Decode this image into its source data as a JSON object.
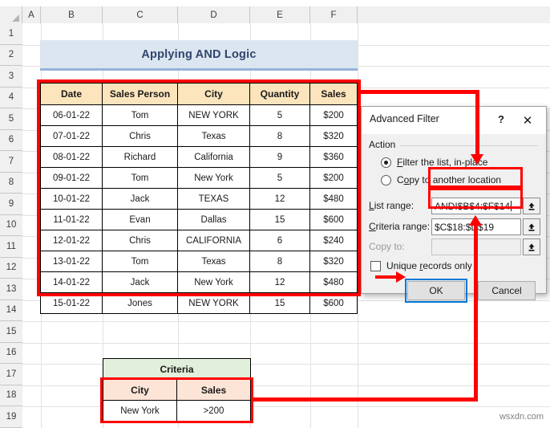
{
  "sheet": {
    "column_headers": [
      "A",
      "B",
      "C",
      "D",
      "E",
      "F"
    ],
    "row_headers": [
      "1",
      "2",
      "3",
      "4",
      "5",
      "6",
      "7",
      "8",
      "9",
      "10",
      "11",
      "12",
      "13",
      "14",
      "15",
      "16",
      "17",
      "18",
      "19"
    ],
    "banner_title": "Applying AND Logic"
  },
  "data_table": {
    "columns": [
      "Date",
      "Sales Person",
      "City",
      "Quantity",
      "Sales"
    ],
    "rows": [
      [
        "06-01-22",
        "Tom",
        "NEW YORK",
        "5",
        "$200"
      ],
      [
        "07-01-22",
        "Chris",
        "Texas",
        "8",
        "$320"
      ],
      [
        "08-01-22",
        "Richard",
        "California",
        "9",
        "$360"
      ],
      [
        "09-01-22",
        "Tom",
        "New York",
        "5",
        "$200"
      ],
      [
        "10-01-22",
        "Jack",
        "TEXAS",
        "12",
        "$480"
      ],
      [
        "11-01-22",
        "Evan",
        "Dallas",
        "15",
        "$600"
      ],
      [
        "12-01-22",
        "Chris",
        "CALIFORNIA",
        "6",
        "$240"
      ],
      [
        "13-01-22",
        "Tom",
        "Texas",
        "8",
        "$320"
      ],
      [
        "14-01-22",
        "Jack",
        "New York",
        "12",
        "$480"
      ],
      [
        "15-01-22",
        "Jones",
        "NEW YORK",
        "15",
        "$600"
      ]
    ]
  },
  "criteria_table": {
    "title": "Criteria",
    "columns": [
      "City",
      "Sales"
    ],
    "rows": [
      [
        "New York",
        ">200"
      ]
    ]
  },
  "dialog": {
    "title": "Advanced Filter",
    "help_glyph": "?",
    "close_glyph": "✕",
    "action_group_label": "Action",
    "radio_filter_in_place": "Filter the list, in-place",
    "radio_filter_in_place_selected": true,
    "radio_copy_another": "Copy to another location",
    "radio_copy_another_selected": false,
    "list_range_label": "List range:",
    "list_range_value": "AND!$B$4:$F$14",
    "criteria_range_label": "Criteria range:",
    "criteria_range_value": "$C$18:$D$19",
    "copy_to_label": "Copy to:",
    "copy_to_value": "",
    "unique_records_label": "Unique records only",
    "unique_records_checked": false,
    "ok_label": "OK",
    "cancel_label": "Cancel",
    "collapse_button_title": "collapse-dialog"
  },
  "colors": {
    "annotation_red": "#ff0000",
    "focus_blue": "#0078d7",
    "banner_fill": "#dce6f1",
    "banner_border": "#95b3d7",
    "header_fill": "#fce4bc",
    "criteria_title_fill": "#e2efda",
    "criteria_header_fill": "#fce4d6"
  },
  "watermark": "wsxdn.com"
}
